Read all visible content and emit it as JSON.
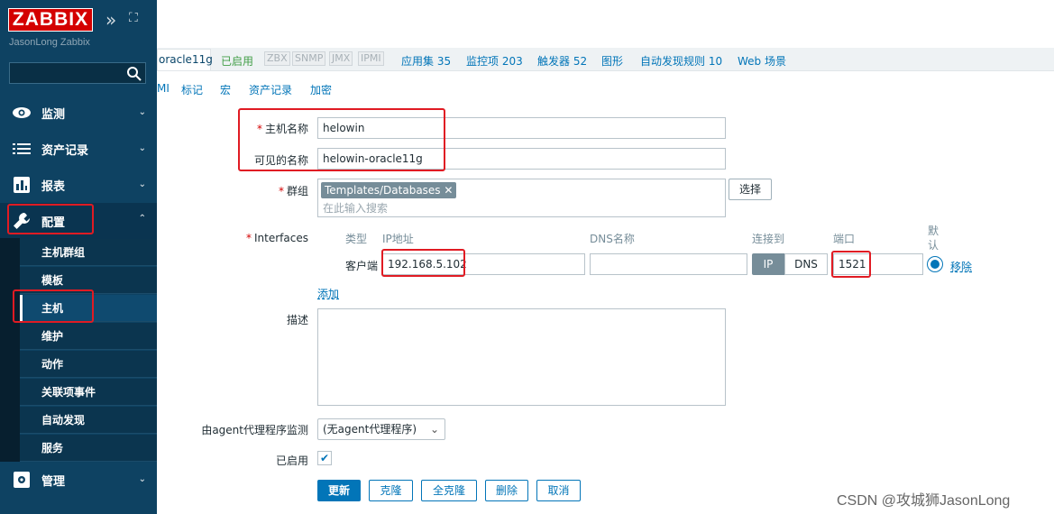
{
  "brand": {
    "logo": "ZABBIX",
    "server": "JasonLong Zabbix",
    "collapse_glyph": "»",
    "fullscreen_glyph": "⛶"
  },
  "sidebar": {
    "search_placeholder": "",
    "menus": [
      {
        "label": "监测",
        "icon": "eye-icon"
      },
      {
        "label": "资产记录",
        "icon": "list-icon"
      },
      {
        "label": "报表",
        "icon": "bar-chart-icon"
      },
      {
        "label": "配置",
        "icon": "wrench-icon"
      },
      {
        "label": "管理",
        "icon": "gear-icon"
      }
    ],
    "submenu": [
      "主机群组",
      "模板",
      "主机",
      "维护",
      "动作",
      "关联项事件",
      "自动发现",
      "服务"
    ],
    "chevron_down": "⌄",
    "chevron_up": "⌃"
  },
  "host_tabs": {
    "host": "oracle11g",
    "enabled": "已启用",
    "badges": [
      "ZBX",
      "SNMP",
      "JMX",
      "IPMI"
    ],
    "links": [
      "应用集 35",
      "监控项 203",
      "触发器 52",
      "图形",
      "自动发现规则 10",
      "Web 场景"
    ]
  },
  "form_tabs": [
    "MI",
    "标记",
    "宏",
    "资产记录",
    "加密"
  ],
  "form": {
    "host_name_label": "主机名称",
    "host_name": "helowin",
    "visible_name_label": "可见的名称",
    "visible_name": "helowin-oracle11g",
    "groups_label": "群组",
    "group_tag": "Templates/Databases",
    "group_remove": "✕",
    "group_placeholder": "在此输入搜索",
    "select_button": "选择",
    "interfaces_label": "Interfaces",
    "iface_headers": {
      "type": "类型",
      "ip": "IP地址",
      "dns": "DNS名称",
      "connect": "连接到",
      "port": "端口",
      "default": "默认"
    },
    "iface": {
      "type": "客户端",
      "ip": "192.168.5.102",
      "dns": "",
      "ip_btn": "IP",
      "dns_btn": "DNS",
      "port": "1521",
      "remove": "移除"
    },
    "add_link": "添加",
    "description_label": "描述",
    "description": "",
    "proxy_label": "由agent代理程序监测",
    "proxy_value": "(无agent代理程序)",
    "enabled_label": "已启用",
    "check_glyph": "✔"
  },
  "actions": {
    "update": "更新",
    "clone": "克隆",
    "full_clone": "全克隆",
    "delete": "删除",
    "cancel": "取消"
  },
  "watermark": "CSDN @攻城狮JasonLong",
  "colors": {
    "accent": "#0275b8",
    "sidebar": "#0e4262",
    "brand": "#d40000",
    "highlight": "#e01b23"
  }
}
